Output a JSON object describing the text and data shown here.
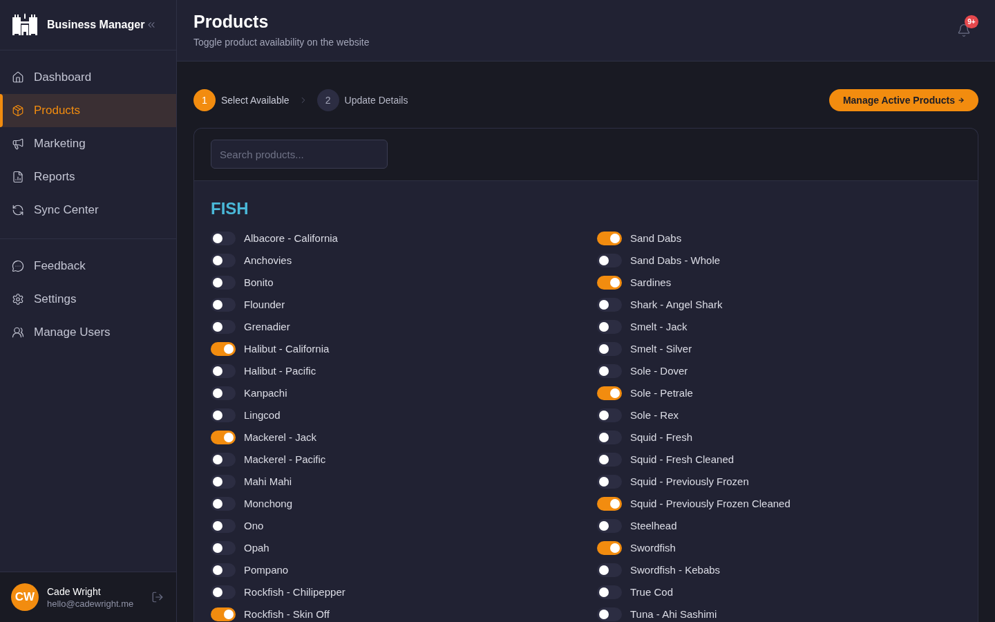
{
  "sidebar": {
    "brand": "Business Manager",
    "nav_groups": [
      [
        {
          "label": "Dashboard",
          "selected": false
        },
        {
          "label": "Products",
          "selected": true
        },
        {
          "label": "Marketing",
          "selected": false
        },
        {
          "label": "Reports",
          "selected": false
        },
        {
          "label": "Sync Center",
          "selected": false
        }
      ],
      [
        {
          "label": "Feedback",
          "selected": false
        },
        {
          "label": "Settings",
          "selected": false
        },
        {
          "label": "Manage Users",
          "selected": false
        }
      ]
    ],
    "user": {
      "initials": "CW",
      "name": "Cade Wright",
      "email": "hello@cadewright.me"
    }
  },
  "header": {
    "title": "Products",
    "subtitle": "Toggle product availability on the website",
    "notification_badge": "9+"
  },
  "stepper": {
    "steps": [
      {
        "number": "1",
        "label": "Select Available",
        "selected": true
      },
      {
        "number": "2",
        "label": "Update Details",
        "selected": false
      }
    ]
  },
  "action_button": "Manage Active Products",
  "search": {
    "placeholder": "Search products..."
  },
  "categories": [
    {
      "name": "FISH",
      "products": [
        {
          "name": "Albacore - California",
          "on": false
        },
        {
          "name": "Anchovies",
          "on": false
        },
        {
          "name": "Bonito",
          "on": false
        },
        {
          "name": "Flounder",
          "on": false
        },
        {
          "name": "Grenadier",
          "on": false
        },
        {
          "name": "Halibut - California",
          "on": true
        },
        {
          "name": "Halibut - Pacific",
          "on": false
        },
        {
          "name": "Kanpachi",
          "on": false
        },
        {
          "name": "Lingcod",
          "on": false
        },
        {
          "name": "Mackerel - Jack",
          "on": true
        },
        {
          "name": "Mackerel - Pacific",
          "on": false
        },
        {
          "name": "Mahi Mahi",
          "on": false
        },
        {
          "name": "Monchong",
          "on": false
        },
        {
          "name": "Ono",
          "on": false
        },
        {
          "name": "Opah",
          "on": false
        },
        {
          "name": "Pompano",
          "on": false
        },
        {
          "name": "Rockfish - Chilipepper",
          "on": false
        },
        {
          "name": "Rockfish - Skin Off",
          "on": true
        },
        {
          "name": "Sand Dabs",
          "on": true
        },
        {
          "name": "Sand Dabs - Whole",
          "on": false
        },
        {
          "name": "Sardines",
          "on": true
        },
        {
          "name": "Shark - Angel Shark",
          "on": false
        },
        {
          "name": "Smelt - Jack",
          "on": false
        },
        {
          "name": "Smelt - Silver",
          "on": false
        },
        {
          "name": "Sole - Dover",
          "on": false
        },
        {
          "name": "Sole - Petrale",
          "on": true
        },
        {
          "name": "Sole - Rex",
          "on": false
        },
        {
          "name": "Squid - Fresh",
          "on": false
        },
        {
          "name": "Squid - Fresh Cleaned",
          "on": false
        },
        {
          "name": "Squid - Previously Frozen",
          "on": false
        },
        {
          "name": "Squid - Previously Frozen Cleaned",
          "on": true
        },
        {
          "name": "Steelhead",
          "on": false
        },
        {
          "name": "Swordfish",
          "on": true
        },
        {
          "name": "Swordfish - Kebabs",
          "on": false
        },
        {
          "name": "True Cod",
          "on": false
        },
        {
          "name": "Tuna - Ahi Sashimi",
          "on": false
        }
      ]
    }
  ]
}
